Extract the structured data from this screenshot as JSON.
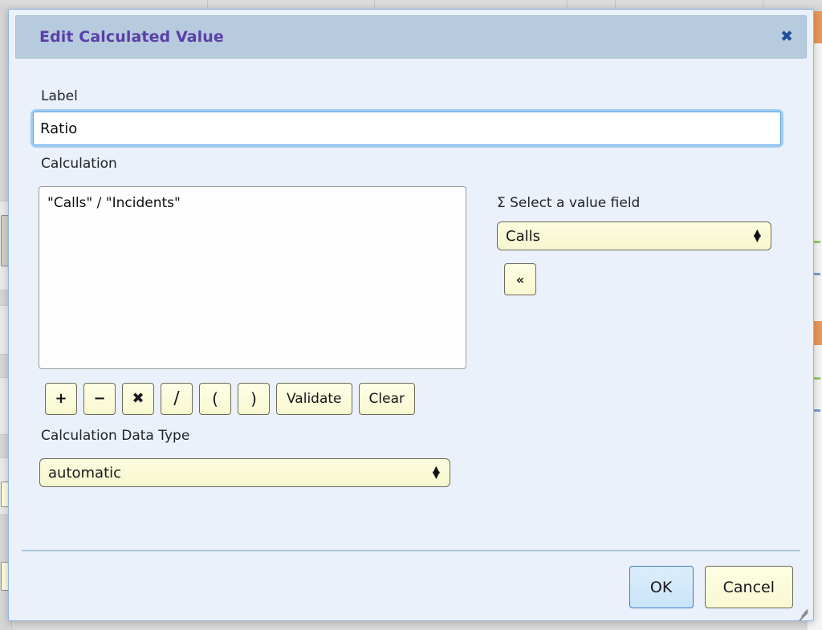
{
  "dialog": {
    "title": "Edit Calculated Value",
    "close_icon": "✖"
  },
  "form": {
    "label_field": {
      "label": "Label",
      "value": "Ratio",
      "placeholder": ""
    },
    "calculation_field": {
      "label": "Calculation",
      "value": "\"Calls\" / \"Incidents\"",
      "placeholder": ""
    },
    "value_field_picker": {
      "label": "Σ Select a value field",
      "sigma_icon": "Σ",
      "selected": "Calls",
      "move_button_label": "«"
    },
    "data_type": {
      "label": "Calculation Data Type",
      "selected": "automatic"
    }
  },
  "operators": [
    {
      "name": "plus",
      "glyph": "+"
    },
    {
      "name": "minus",
      "glyph": "−"
    },
    {
      "name": "multiply",
      "glyph": "✖"
    },
    {
      "name": "divide",
      "glyph": "∕"
    },
    {
      "name": "open-paren",
      "glyph": "("
    },
    {
      "name": "close-paren",
      "glyph": ")"
    }
  ],
  "actions": {
    "validate_label": "Validate",
    "clear_label": "Clear"
  },
  "footer": {
    "ok_label": "OK",
    "cancel_label": "Cancel"
  },
  "colors": {
    "dialog_background": "#eaf1fa",
    "titlebar_background": "#b6cbdd",
    "title_text": "#5b3fa8",
    "close_icon": "#1f4e9c",
    "yellow_control": "#fcfcdf",
    "primary_button": "#c9e4f8",
    "focus_ring": "#66afe9",
    "divider": "#a8c4dd"
  }
}
